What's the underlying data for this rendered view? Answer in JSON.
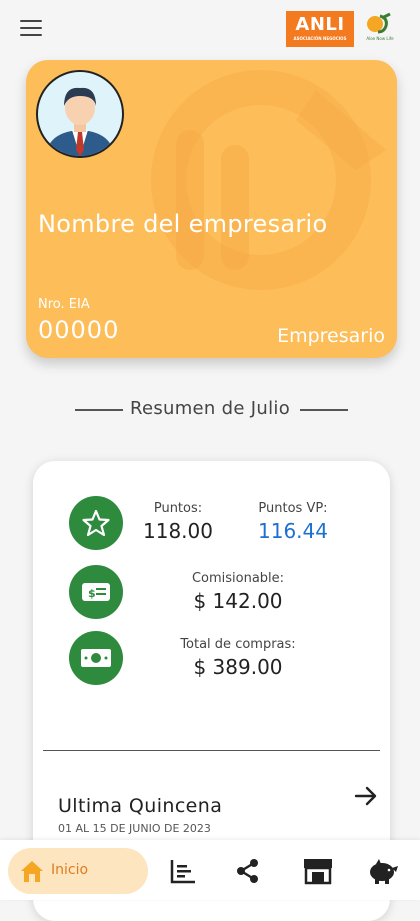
{
  "header": {
    "menu_icon": "hamburger-menu-icon",
    "logo_anli_text": "ANLI",
    "logo_anli_subtext": "ASOCIACIÓN NEGOCIOS",
    "logo_aloe_text": "Aloe Now Life"
  },
  "card": {
    "name": "Nombre del empresario",
    "eia_label": "Nro. EIA",
    "eia_value": "00000",
    "role": "Empresario",
    "color": "#fdbd58"
  },
  "summary": {
    "title": "Resumen de Julio",
    "puntos_label": "Puntos:",
    "puntos_value": "118.00",
    "puntos_vp_label": "Puntos VP:",
    "puntos_vp_value": "116.44",
    "comisionable_label": "Comisionable:",
    "comisionable_value": "$ 142.00",
    "compras_label": "Total de compras:",
    "compras_value": "$ 389.00",
    "icon_color": "#2e8b3e",
    "accent_blue": "#1e6fd1"
  },
  "quincena": {
    "title": "Ultima Quincena",
    "date": "01 AL 15 DE JUNIO DE 2023"
  },
  "bottom_nav": {
    "home_label": "Inicio",
    "items": [
      "home-icon",
      "stats-list-icon",
      "share-icon",
      "store-icon",
      "piggy-bank-icon"
    ],
    "active_color": "#e07c1c"
  }
}
